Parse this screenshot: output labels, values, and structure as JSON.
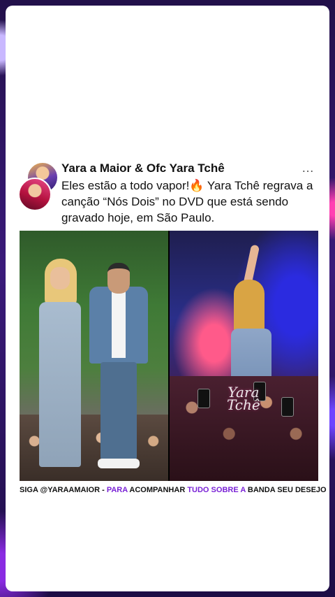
{
  "post": {
    "author_name": "Yara a Maior & Ofc Yara Tchê",
    "more_icon": "…",
    "text": "Eles estão a todo vapor!🔥 Yara Tchê regrava a canção “Nós Dois” no DVD que está sendo gravado hoje, em São Paulo."
  },
  "media": {
    "right_watermark_line1": "Yara",
    "right_watermark_line2": "Tchê"
  },
  "caption": {
    "part1": "SIGA @YARAAMAIOR - ",
    "part2": "PARA",
    "part3": " ACOMPANHAR ",
    "part4": "TUDO SOBRE A",
    "part5": " BANDA SEU DESEJO"
  },
  "colors": {
    "highlight": "#7a22d6",
    "card_bg": "#ffffff",
    "page_bg": "#22104a"
  }
}
